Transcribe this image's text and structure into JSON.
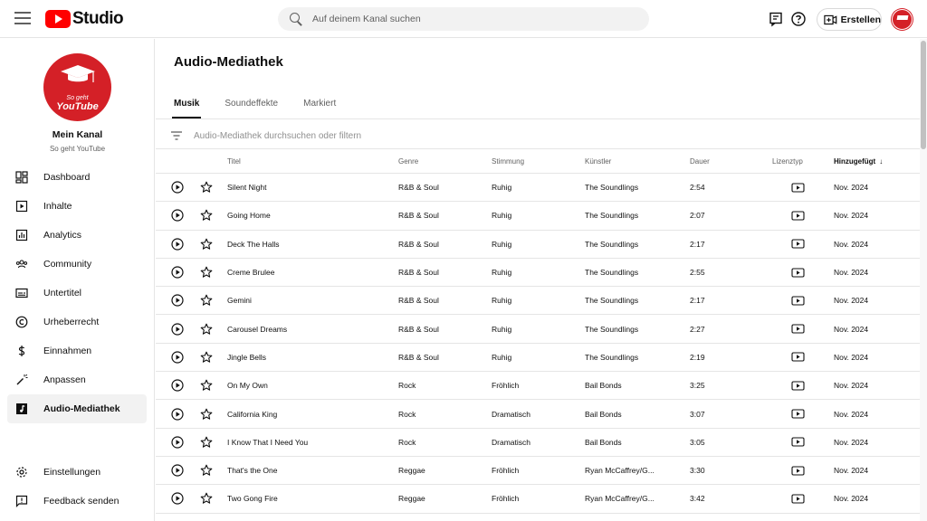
{
  "header": {
    "logo_text": "Studio",
    "search_placeholder": "Auf deinem Kanal suchen",
    "create_label": "Erstellen"
  },
  "channel": {
    "name": "Mein Kanal",
    "handle": "So geht YouTube",
    "avatar_small": "So geht",
    "avatar_big": "YouTube"
  },
  "sidebar": {
    "items": [
      {
        "label": "Dashboard",
        "icon": "dashboard-icon"
      },
      {
        "label": "Inhalte",
        "icon": "content-icon"
      },
      {
        "label": "Analytics",
        "icon": "analytics-icon"
      },
      {
        "label": "Community",
        "icon": "community-icon"
      },
      {
        "label": "Untertitel",
        "icon": "subtitles-icon"
      },
      {
        "label": "Urheberrecht",
        "icon": "copyright-icon"
      },
      {
        "label": "Einnahmen",
        "icon": "dollar-icon"
      },
      {
        "label": "Anpassen",
        "icon": "magic-wand-icon"
      },
      {
        "label": "Audio-Mediathek",
        "icon": "audio-library-icon"
      }
    ],
    "bottom": [
      {
        "label": "Einstellungen",
        "icon": "gear-icon"
      },
      {
        "label": "Feedback senden",
        "icon": "feedback-icon"
      }
    ]
  },
  "main": {
    "title": "Audio-Mediathek",
    "tabs": [
      {
        "label": "Musik"
      },
      {
        "label": "Soundeffekte"
      },
      {
        "label": "Markiert"
      }
    ],
    "filter_placeholder": "Audio-Mediathek durchsuchen oder filtern"
  },
  "table": {
    "headers": {
      "title": "Titel",
      "genre": "Genre",
      "mood": "Stimmung",
      "artist": "Künstler",
      "duration": "Dauer",
      "license": "Lizenztyp",
      "added": "Hinzugefügt",
      "sort_arrow": "↓"
    },
    "rows": [
      {
        "title": "Silent Night",
        "genre": "R&B & Soul",
        "mood": "Ruhig",
        "artist": "The Soundlings",
        "duration": "2:54",
        "added": "Nov. 2024"
      },
      {
        "title": "Going Home",
        "genre": "R&B & Soul",
        "mood": "Ruhig",
        "artist": "The Soundlings",
        "duration": "2:07",
        "added": "Nov. 2024"
      },
      {
        "title": "Deck The Halls",
        "genre": "R&B & Soul",
        "mood": "Ruhig",
        "artist": "The Soundlings",
        "duration": "2:17",
        "added": "Nov. 2024"
      },
      {
        "title": "Creme Brulee",
        "genre": "R&B & Soul",
        "mood": "Ruhig",
        "artist": "The Soundlings",
        "duration": "2:55",
        "added": "Nov. 2024"
      },
      {
        "title": "Gemini",
        "genre": "R&B & Soul",
        "mood": "Ruhig",
        "artist": "The Soundlings",
        "duration": "2:17",
        "added": "Nov. 2024"
      },
      {
        "title": "Carousel Dreams",
        "genre": "R&B & Soul",
        "mood": "Ruhig",
        "artist": "The Soundlings",
        "duration": "2:27",
        "added": "Nov. 2024"
      },
      {
        "title": "Jingle Bells",
        "genre": "R&B & Soul",
        "mood": "Ruhig",
        "artist": "The Soundlings",
        "duration": "2:19",
        "added": "Nov. 2024"
      },
      {
        "title": "On My Own",
        "genre": "Rock",
        "mood": "Fröhlich",
        "artist": "Bail Bonds",
        "duration": "3:25",
        "added": "Nov. 2024"
      },
      {
        "title": "California King",
        "genre": "Rock",
        "mood": "Dramatisch",
        "artist": "Bail Bonds",
        "duration": "3:07",
        "added": "Nov. 2024"
      },
      {
        "title": "I Know That I Need You",
        "genre": "Rock",
        "mood": "Dramatisch",
        "artist": "Bail Bonds",
        "duration": "3:05",
        "added": "Nov. 2024"
      },
      {
        "title": "That's the One",
        "genre": "Reggae",
        "mood": "Fröhlich",
        "artist": "Ryan McCaffrey/G...",
        "duration": "3:30",
        "added": "Nov. 2024"
      },
      {
        "title": "Two Gong Fire",
        "genre": "Reggae",
        "mood": "Fröhlich",
        "artist": "Ryan McCaffrey/G...",
        "duration": "3:42",
        "added": "Nov. 2024"
      }
    ]
  },
  "colors": {
    "brand_red": "#ff0000",
    "avatar_red": "#d42027",
    "text": "#0f0f0f",
    "secondary_text": "#606060",
    "divider": "#e5e5e5"
  }
}
